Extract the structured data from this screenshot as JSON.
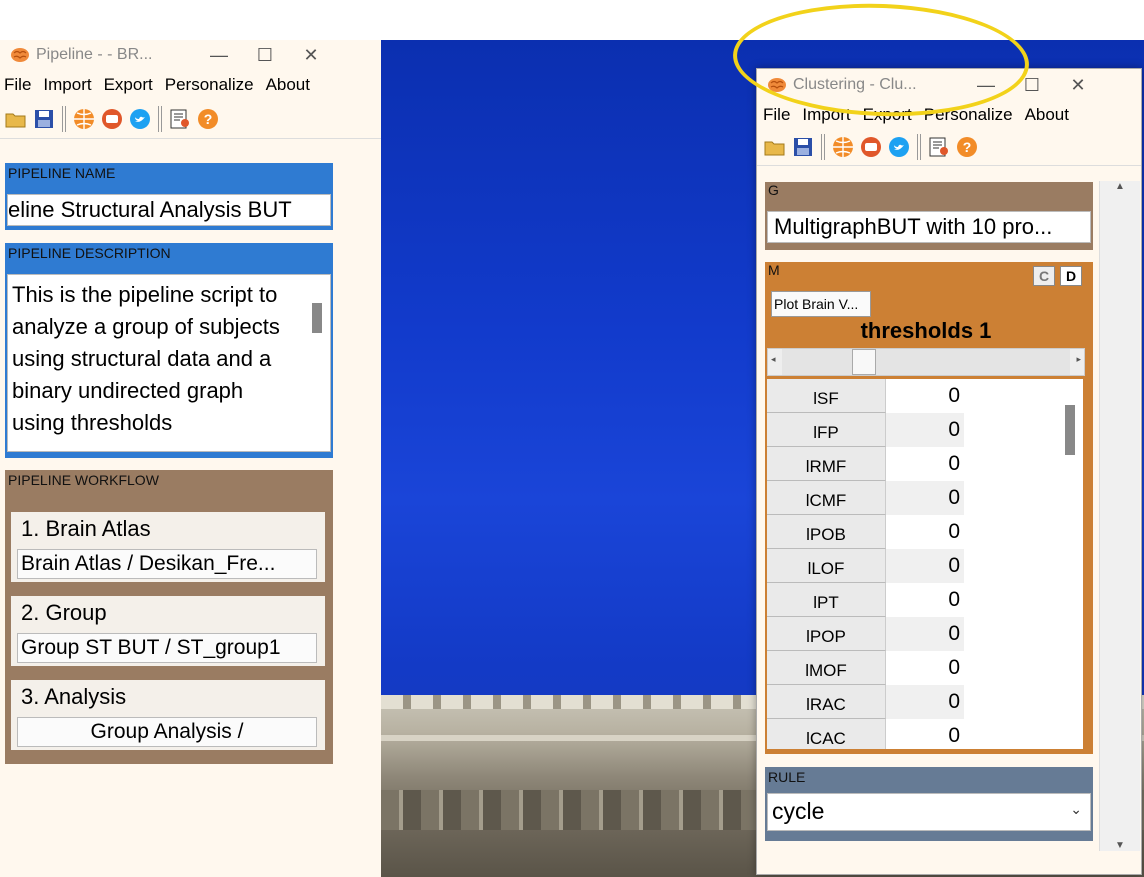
{
  "pipeline_window": {
    "title": "Pipeline -  - BR...",
    "controls": {
      "minimize": "—",
      "maximize": "☐",
      "close": "✕"
    },
    "menu": [
      "File",
      "Import",
      "Export",
      "Personalize",
      "About"
    ],
    "name_label": "PIPELINE NAME",
    "name_value": "eline Structural Analysis BUT",
    "description_label": "PIPELINE DESCRIPTION",
    "description_value": "This is the pipeline script to analyze a group of subjects using structural data and a binary undirected graph using thresholds",
    "workflow_label": "PIPELINE WORKFLOW",
    "steps": [
      {
        "title": "1. Brain Atlas",
        "button": "Brain Atlas / Desikan_Fre..."
      },
      {
        "title": "2. Group",
        "button": "Group ST BUT / ST_group1"
      },
      {
        "title": "3. Analysis",
        "button": "Group Analysis /"
      }
    ]
  },
  "clustering_window": {
    "title": "Clustering - Clu...",
    "controls": {
      "minimize": "—",
      "maximize": "☐",
      "close": "✕"
    },
    "menu": [
      "File",
      "Import",
      "Export",
      "Personalize",
      "About"
    ],
    "g_label": "G",
    "g_value": "MultigraphBUT with 10 pro...",
    "m_label": "M",
    "c_button": "C",
    "d_button": "D",
    "plot_button": "Plot Brain V...",
    "thresholds_title": "thresholds 1",
    "table_rows": [
      {
        "name": "lSF",
        "value": "0"
      },
      {
        "name": "lFP",
        "value": "0"
      },
      {
        "name": "lRMF",
        "value": "0"
      },
      {
        "name": "lCMF",
        "value": "0"
      },
      {
        "name": "lPOB",
        "value": "0"
      },
      {
        "name": "lLOF",
        "value": "0"
      },
      {
        "name": "lPT",
        "value": "0"
      },
      {
        "name": "lPOP",
        "value": "0"
      },
      {
        "name": "lMOF",
        "value": "0"
      },
      {
        "name": "lRAC",
        "value": "0"
      },
      {
        "name": "lCAC",
        "value": "0"
      }
    ],
    "rule_label": "RULE",
    "rule_value": "cycle"
  },
  "colors": {
    "blue_panel": "#2f7bd2",
    "brown_panel": "#9a7c62",
    "orange_panel": "#cc8034",
    "slate_panel": "#667b95",
    "highlight": "#f2d21a"
  }
}
